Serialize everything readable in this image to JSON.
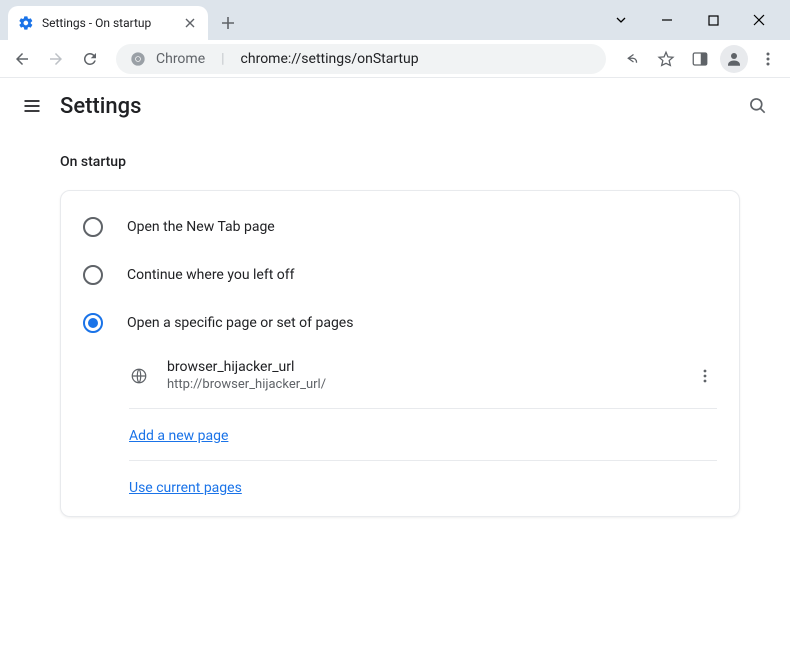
{
  "window": {
    "tab": {
      "title": "Settings - On startup"
    }
  },
  "omnibox": {
    "scheme_label": "Chrome",
    "url": "chrome://settings/onStartup"
  },
  "app": {
    "title": "Settings"
  },
  "section": {
    "title": "On startup",
    "options": {
      "new_tab": {
        "label": "Open the New Tab page",
        "selected": false
      },
      "continue": {
        "label": "Continue where you left off",
        "selected": false
      },
      "specific": {
        "label": "Open a specific page or set of pages",
        "selected": true
      }
    },
    "pages": [
      {
        "title": "browser_hijacker_url",
        "url": "http://browser_hijacker_url/"
      }
    ],
    "add_page_label": "Add a new page",
    "use_current_label": "Use current pages"
  }
}
